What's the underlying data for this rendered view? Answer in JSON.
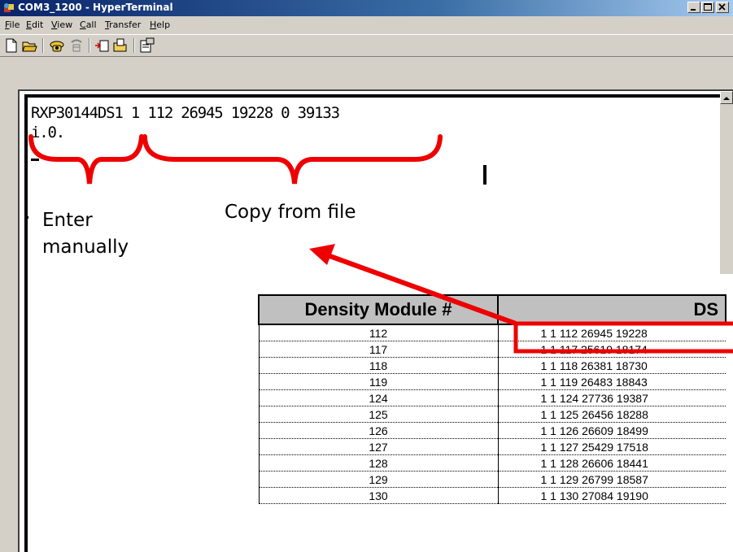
{
  "window": {
    "title": "COM3_1200 - HyperTerminal",
    "controls": [
      "minimize",
      "maximize",
      "close"
    ]
  },
  "menu": [
    "File",
    "Edit",
    "View",
    "Call",
    "Transfer",
    "Help"
  ],
  "toolbar": {
    "buttons": [
      "new-document-icon",
      "open-folder-icon",
      "connect-phone-icon",
      "disconnect-phone-icon",
      "send-icon",
      "receive-icon",
      "properties-icon"
    ]
  },
  "terminal": {
    "lines": [
      "RXP30144DS1 1 112 26945 19228 0 39133",
      "i.0."
    ]
  },
  "annotations": {
    "enter": "Enter",
    "manually": "manually",
    "copy_from_file": "Copy from file",
    "brace_color": "#ee0000"
  },
  "table": {
    "headers": [
      "Density Module #",
      "DS"
    ],
    "rows": [
      [
        "112",
        "1 1 112 26945 19228"
      ],
      [
        "117",
        "1 1 117 25619 18174"
      ],
      [
        "118",
        "1 1 118 26381 18730"
      ],
      [
        "119",
        "1 1 119 26483 18843"
      ],
      [
        "124",
        "1 1 124 27736 19387"
      ],
      [
        "125",
        "1 1 125 26456 18288"
      ],
      [
        "126",
        "1 1 126 26609 18499"
      ],
      [
        "127",
        "1 1 127 25429 17518"
      ],
      [
        "128",
        "1 1 128 26606 18441"
      ],
      [
        "129",
        "1 1 129 26799 18587"
      ],
      [
        "130",
        "1 1 130 27084 19190"
      ]
    ]
  }
}
